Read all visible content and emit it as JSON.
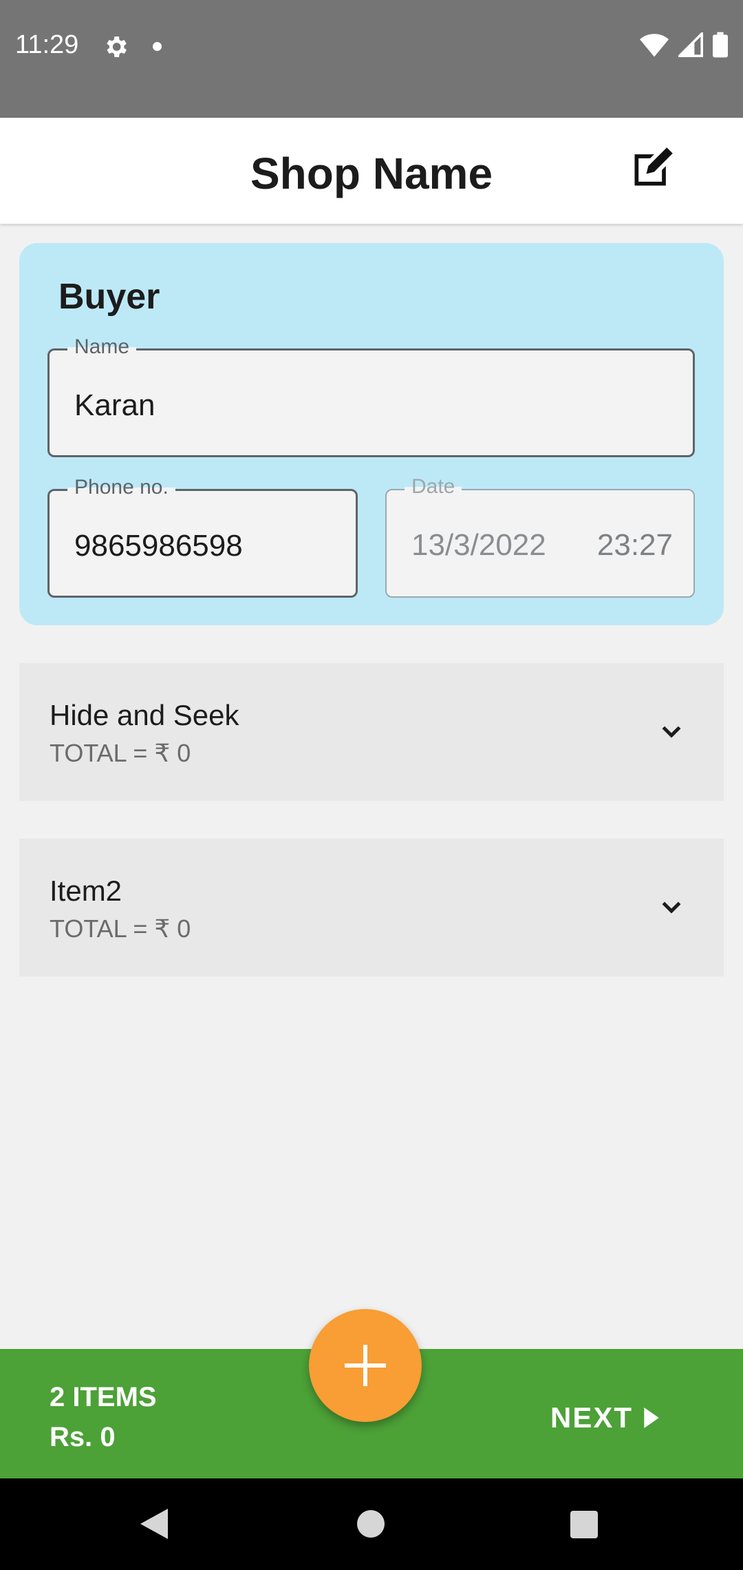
{
  "status_bar": {
    "time": "11:29",
    "icons": [
      "gear-icon",
      "notification-dot",
      "wifi-icon",
      "signal-icon",
      "battery-icon"
    ]
  },
  "app_bar": {
    "title": "Shop Name",
    "edit_icon": "edit-icon"
  },
  "buyer": {
    "title": "Buyer",
    "name_label": "Name",
    "name_value": "Karan",
    "phone_label": "Phone no.",
    "phone_value": "9865986598",
    "date_label": "Date",
    "date_value": "13/3/2022",
    "time_value": "23:27"
  },
  "items": [
    {
      "name": "Hide and Seek",
      "total": "TOTAL = ₹ 0"
    },
    {
      "name": "Item2",
      "total": "TOTAL = ₹ 0"
    }
  ],
  "bottom_bar": {
    "count": "2 ITEMS",
    "total": "Rs. 0",
    "next_label": "NEXT"
  },
  "fab_icon": "plus-icon",
  "colors": {
    "status_bar": "#757575",
    "buyer_card": "#bde9f7",
    "item_row": "#e8e8e8",
    "bottom_bar": "#4ca137",
    "fab": "#f99d35",
    "nav_bar": "#000000"
  }
}
